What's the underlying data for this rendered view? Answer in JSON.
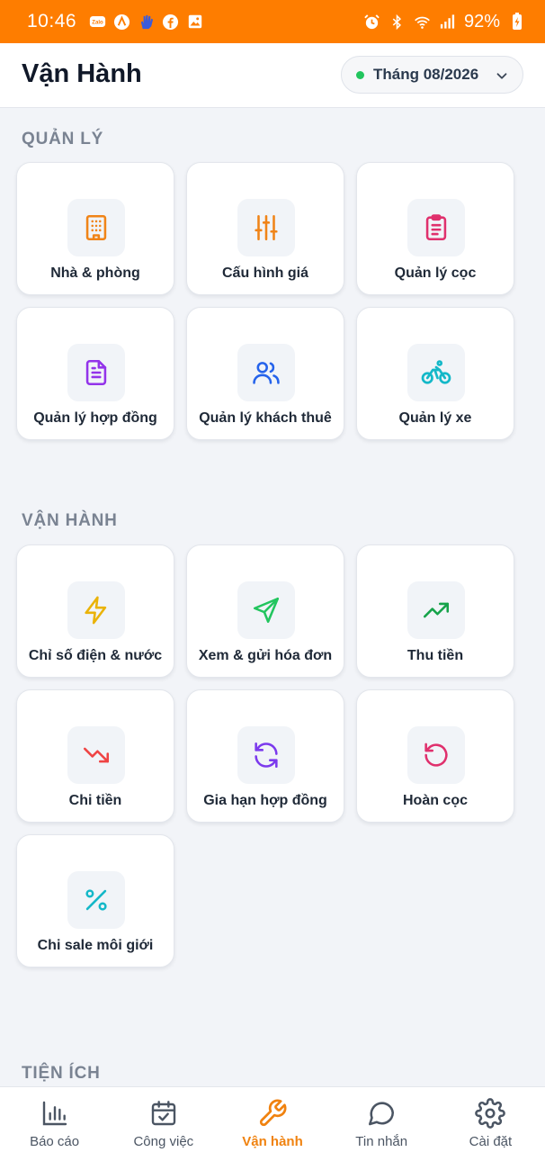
{
  "status_bar": {
    "time": "10:46",
    "left_icons": [
      "zalo-icon",
      "a-icon",
      "hand-icon",
      "facebook-icon",
      "image-icon"
    ],
    "right_icons": [
      "alarm-icon",
      "bluetooth-icon",
      "wifi-icon",
      "signal-icon"
    ],
    "battery": "92%"
  },
  "header": {
    "title": "Vận Hành",
    "month_label": "Tháng 08/2026"
  },
  "sections": {
    "quanly": {
      "title": "QUẢN LÝ",
      "items": [
        {
          "label": "Nhà & phòng",
          "icon": "building-icon",
          "color": "#f08418"
        },
        {
          "label": "Cấu hình giá",
          "icon": "sliders-icon",
          "color": "#f08418"
        },
        {
          "label": "Quản lý cọc",
          "icon": "clipboard-icon",
          "color": "#e0306d"
        },
        {
          "label": "Quản lý hợp đồng",
          "icon": "document-icon",
          "color": "#9333ea"
        },
        {
          "label": "Quản lý khách thuê",
          "icon": "users-icon",
          "color": "#2563eb"
        },
        {
          "label": "Quản lý xe",
          "icon": "bicycle-icon",
          "color": "#14b8c8"
        }
      ]
    },
    "vanhanh": {
      "title": "VẬN HÀNH",
      "items": [
        {
          "label": "Chỉ số điện & nước",
          "icon": "lightning-icon",
          "color": "#eab308"
        },
        {
          "label": "Xem & gửi hóa đơn",
          "icon": "send-icon",
          "color": "#22c55e"
        },
        {
          "label": "Thu tiền",
          "icon": "trending-up-icon",
          "color": "#16a34a"
        },
        {
          "label": "Chi tiền",
          "icon": "trending-down-icon",
          "color": "#ef4444"
        },
        {
          "label": "Gia hạn hợp đồng",
          "icon": "refresh-icon",
          "color": "#7c3aed"
        },
        {
          "label": "Hoàn cọc",
          "icon": "undo-icon",
          "color": "#e0306d"
        },
        {
          "label": "Chi sale môi giới",
          "icon": "percent-icon",
          "color": "#14b8c8"
        }
      ]
    },
    "tienich": {
      "title": "TIỆN ÍCH"
    }
  },
  "bottom_nav": {
    "active_color": "#f0820f",
    "items": [
      {
        "label": "Báo cáo",
        "icon": "bar-chart-icon"
      },
      {
        "label": "Công việc",
        "icon": "calendar-check-icon"
      },
      {
        "label": "Vận hành",
        "icon": "wrench-icon",
        "active": true
      },
      {
        "label": "Tin nhắn",
        "icon": "chat-icon"
      },
      {
        "label": "Cài đặt",
        "icon": "gear-icon"
      }
    ]
  }
}
